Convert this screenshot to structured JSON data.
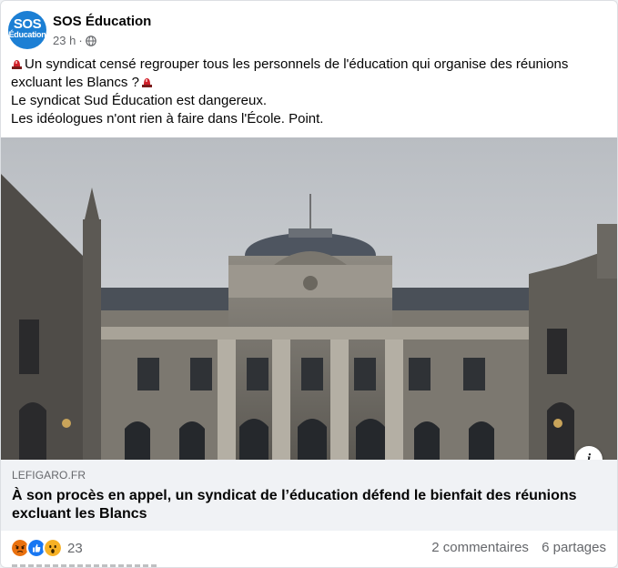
{
  "post": {
    "page_name": "SOS Éducation",
    "avatar_text_top": "SOS",
    "avatar_text_bottom": "Éducation",
    "time": "23 h",
    "separator": "·",
    "visibility_icon": "globe-icon",
    "text_line_1": "Un syndicat censé regrouper tous les personnels de l'éducation qui organise des réunions excluant les Blancs ?",
    "text_line_2": "Le syndicat Sud Éducation est dangereux.",
    "text_line_3": "Les idéologues n'ont rien à faire dans l'École. Point.",
    "emoji_icon": "police-siren-icon"
  },
  "link_preview": {
    "domain": "LEFIGARO.FR",
    "headline": "À son procès en appel, un syndicat de l’éducation défend le bienfait des réunions excluant les Blancs",
    "info_label": "i"
  },
  "footer": {
    "reaction_icons": [
      "angry-icon",
      "like-icon",
      "wow-icon"
    ],
    "reaction_count": "23",
    "comments": "2 commentaires",
    "shares": "6 partages"
  },
  "colors": {
    "brand_blue": "#1c7fd4",
    "like_blue": "#1877f2",
    "angry_orange": "#e9710f",
    "wow_yellow": "#f7b125",
    "muted_text": "#65676b"
  }
}
